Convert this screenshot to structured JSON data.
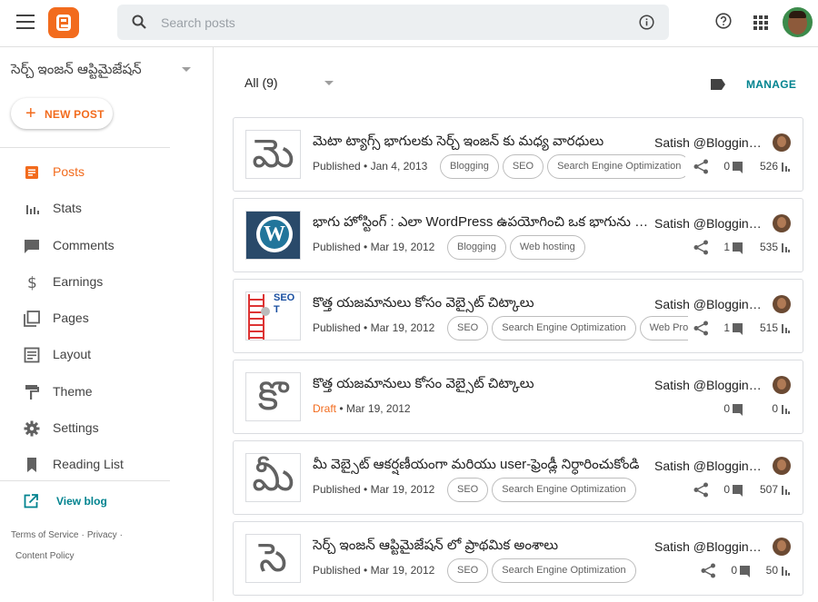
{
  "header": {
    "search_placeholder": "Search posts",
    "brand_color": "#f26b1d"
  },
  "sidebar": {
    "blog_name": "సెర్చ్ ఇంజన్ ఆప్టిమైజేషన్",
    "new_post_label": "NEW POST",
    "items": [
      {
        "label": "Posts",
        "icon": "posts-icon",
        "active": true
      },
      {
        "label": "Stats",
        "icon": "stats-icon"
      },
      {
        "label": "Comments",
        "icon": "comments-icon"
      },
      {
        "label": "Earnings",
        "icon": "dollar-icon"
      },
      {
        "label": "Pages",
        "icon": "pages-icon"
      },
      {
        "label": "Layout",
        "icon": "layout-icon"
      },
      {
        "label": "Theme",
        "icon": "paint-roller-icon"
      },
      {
        "label": "Settings",
        "icon": "gear-icon"
      },
      {
        "label": "Reading List",
        "icon": "bookmark-icon"
      }
    ],
    "view_blog_label": "View blog",
    "footer": {
      "terms": "Terms of Service",
      "privacy": "Privacy",
      "content_policy": "Content Policy",
      "sep": "·"
    }
  },
  "main": {
    "filter_label": "All (9)",
    "manage_label": "MANAGE",
    "posts": [
      {
        "thumb": "మె",
        "title": "మెటా ట్యాగ్స్ భాగులకు సెర్చ్ ఇంజన్ కు మధ్య వారధులు",
        "author": "Satish @Blogging...",
        "status": "Published",
        "date": "Jan 4, 2013",
        "labels": [
          "Blogging",
          "SEO",
          "Search Engine Optimization"
        ],
        "comments": "0",
        "views": "526"
      },
      {
        "thumb": "",
        "title": "భాగు హోస్టింగ్ : ఎలా WordPress ఉపయోగించి ఒక భాగును ఏర్పాటు చేసుకోవాలి",
        "author": "Satish @Blogging...",
        "status": "Published",
        "date": "Mar 19, 2012",
        "labels": [
          "Blogging",
          "Web hosting"
        ],
        "comments": "1",
        "views": "535"
      },
      {
        "thumb": "",
        "thumb_text": "SEO T",
        "title": "కొత్త యజమానులు కోసం వెబ్సైట్ చిట్కాలు",
        "author": "Satish @Blogging...",
        "status": "Published",
        "date": "Mar 19, 2012",
        "labels": [
          "SEO",
          "Search Engine Optimization",
          "Web Promotion"
        ],
        "comments": "1",
        "views": "515"
      },
      {
        "thumb": "కొ",
        "title": "కొత్త యజమానులు కోసం వెబ్సైట్ చిట్కాలు",
        "author": "Satish @Blogging...",
        "status": "Draft",
        "date": "Mar 19, 2012",
        "labels": [],
        "comments": "0",
        "views": "0"
      },
      {
        "thumb": "మీ",
        "title": "మీ వెబ్సైట్ ఆకర్షణీయంగా మరియు user-ఫ్రెండ్లీ నిర్ధారించుకోండి",
        "author": "Satish @Blogging...",
        "status": "Published",
        "date": "Mar 19, 2012",
        "labels": [
          "SEO",
          "Search Engine Optimization"
        ],
        "comments": "0",
        "views": "507"
      },
      {
        "thumb": "సె",
        "title": "సెర్చ్ ఇంజన్ ఆప్టిమైజేషన్ లో ప్రాథమిక అంశాలు",
        "author": "Satish @Blogging...",
        "status": "Published",
        "date": "Mar 19, 2012",
        "labels": [
          "SEO",
          "Search Engine Optimization"
        ],
        "comments": "0",
        "views": "50"
      }
    ]
  }
}
